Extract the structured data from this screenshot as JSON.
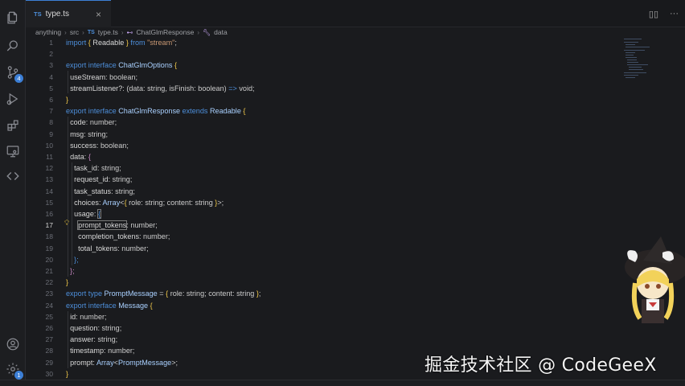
{
  "tab": {
    "badge": "TS",
    "label": "type.ts",
    "close": "×"
  },
  "breadcrumb": {
    "items": [
      "anything",
      "src",
      "type.ts",
      "ChatGlmResponse",
      "data"
    ],
    "file_badge": "TS"
  },
  "watermark": "掘金技术社区 @ CodeGeeX",
  "activity": {
    "scm_badge": "4",
    "settings_badge": "1"
  },
  "lines": [
    {
      "n": "1"
    },
    {
      "n": "2"
    },
    {
      "n": "3"
    },
    {
      "n": "4"
    },
    {
      "n": "5"
    },
    {
      "n": "6"
    },
    {
      "n": "7"
    },
    {
      "n": "8"
    },
    {
      "n": "9"
    },
    {
      "n": "10"
    },
    {
      "n": "11"
    },
    {
      "n": "12"
    },
    {
      "n": "13"
    },
    {
      "n": "14"
    },
    {
      "n": "15"
    },
    {
      "n": "16"
    },
    {
      "n": "17"
    },
    {
      "n": "18"
    },
    {
      "n": "19"
    },
    {
      "n": "20"
    },
    {
      "n": "21"
    },
    {
      "n": "22"
    },
    {
      "n": "23"
    },
    {
      "n": "24"
    },
    {
      "n": "25"
    },
    {
      "n": "26"
    },
    {
      "n": "27"
    },
    {
      "n": "28"
    },
    {
      "n": "29"
    },
    {
      "n": "30"
    }
  ],
  "code": {
    "l1": {
      "k": "import",
      "o": "{",
      "id": " Readable ",
      "c": "}",
      "from": " from ",
      "str": "\"stream\"",
      "end": ";"
    },
    "l3": {
      "k1": "export",
      "k2": " interface ",
      "name": "ChatGlmOptions",
      "o": " {"
    },
    "l4": {
      "prop": "useStream",
      "rest": ": boolean;"
    },
    "l5": {
      "prop": "streamListener?",
      "rest": ": (data: string, isFinish: boolean) ",
      "arrow": "=>",
      "ret": " void;"
    },
    "l6": {
      "c": "}"
    },
    "l7": {
      "k1": "export",
      "k2": " interface ",
      "name": "ChatGlmResponse",
      "k3": " extends ",
      "base": "Readable",
      "o": " {"
    },
    "l8": {
      "prop": "code",
      "rest": ": number;"
    },
    "l9": {
      "prop": "msg",
      "rest": ": string;"
    },
    "l10": {
      "prop": "success",
      "rest": ": boolean;"
    },
    "l11": {
      "prop": "data",
      "rest": ": ",
      "o": "{"
    },
    "l12": {
      "prop": "task_id",
      "rest": ": string;"
    },
    "l13": {
      "prop": "request_id",
      "rest": ": string;"
    },
    "l14": {
      "prop": "task_status",
      "rest": ": string;"
    },
    "l15": {
      "prop": "choices",
      "rest": ": ",
      "arr": "Array",
      "lt": "<",
      "o": "{",
      "mid": " role: string; content: string ",
      "c": "}",
      "gt": ">",
      "end": ";"
    },
    "l16": {
      "prop": "usage",
      "rest": ": ",
      "o": "{"
    },
    "l17": {
      "prop": "prompt_tokens",
      "rest": ": number;"
    },
    "l18": {
      "prop": "completion_tokens",
      "rest": ": number;"
    },
    "l19": {
      "prop": "total_tokens",
      "rest": ": number;"
    },
    "l20": {
      "c": "};"
    },
    "l21": {
      "c": "};"
    },
    "l22": {
      "c": "}"
    },
    "l23": {
      "k1": "export",
      "k2": " type ",
      "name": "PromptMessage",
      "eq": " = ",
      "o": "{",
      "mid": " role: string; content: string ",
      "c": "}",
      "end": ";"
    },
    "l24": {
      "k1": "export",
      "k2": " interface ",
      "name": "Message",
      "o": " {"
    },
    "l25": {
      "prop": "id",
      "rest": ": number;"
    },
    "l26": {
      "prop": "question",
      "rest": ": string;"
    },
    "l27": {
      "prop": "answer",
      "rest": ": string;"
    },
    "l28": {
      "prop": "timestamp",
      "rest": ": number;"
    },
    "l29": {
      "prop": "prompt",
      "rest": ": ",
      "arr": "Array",
      "lt": "<",
      "inner": "PromptMessage",
      "gt": ">",
      "end": ";"
    },
    "l30": {
      "c": "}"
    }
  },
  "colors": {
    "keyword": "#4d8fdb",
    "string": "#c99873",
    "bracket": "#f0c84a",
    "accent": "#3c7fd6"
  }
}
